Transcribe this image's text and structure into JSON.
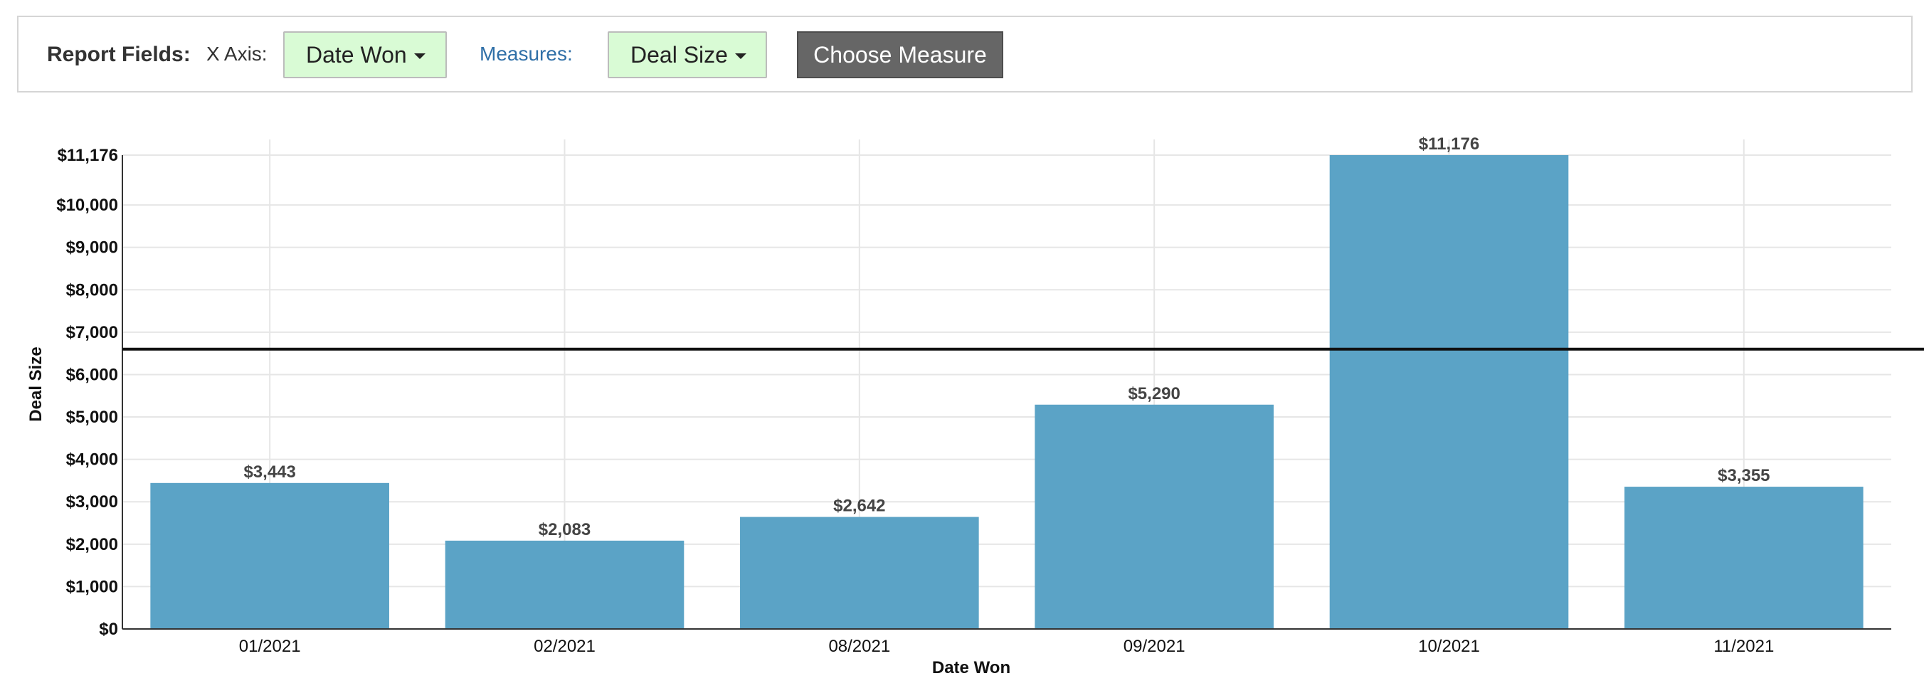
{
  "report_fields": {
    "title": "Report Fields:",
    "x_axis_label": "X Axis:",
    "x_axis_value": "Date Won",
    "measures_label": "Measures:",
    "measure_value": "Deal Size",
    "choose_button": "Choose Measure"
  },
  "colors": {
    "bar": "#5ba3c6",
    "dropdown_bg": "#d9fbd5",
    "button_bg": "#666666",
    "measures_link": "#2f6fa7"
  },
  "icons": {
    "dropdown": "caret-down-icon"
  },
  "chart_data": {
    "type": "bar",
    "categories": [
      "01/2021",
      "02/2021",
      "08/2021",
      "09/2021",
      "10/2021",
      "11/2021"
    ],
    "values": [
      3443,
      2083,
      2642,
      5290,
      11176,
      3355
    ],
    "data_labels": [
      "$3,443",
      "$2,083",
      "$2,642",
      "$5,290",
      "$11,176",
      "$3,355"
    ],
    "xlabel": "Date Won",
    "ylabel": "Deal Size",
    "ylim": [
      0,
      11176
    ],
    "yticks": [
      0,
      1000,
      2000,
      3000,
      4000,
      5000,
      6000,
      7000,
      8000,
      9000,
      10000,
      11176
    ],
    "ytick_labels": [
      "$0",
      "$1,000",
      "$2,000",
      "$3,000",
      "$4,000",
      "$5,000",
      "$6,000",
      "$7,000",
      "$8,000",
      "$9,000",
      "$10,000",
      "$11,176"
    ],
    "reference_line": 6598,
    "grid": true
  }
}
